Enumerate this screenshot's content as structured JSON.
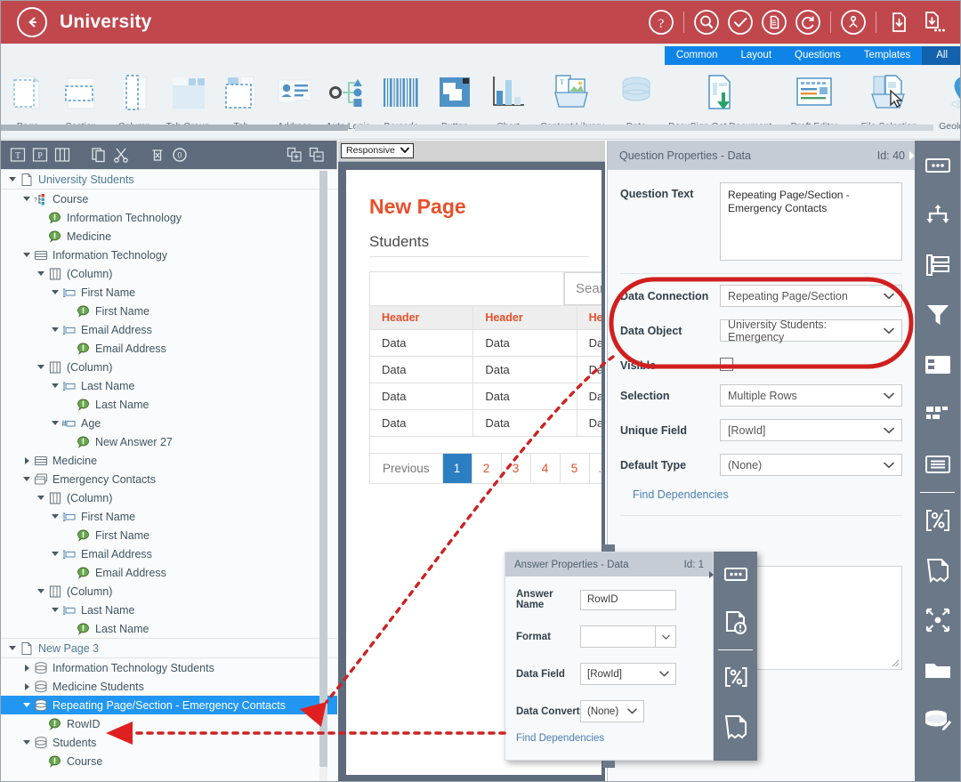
{
  "titlebar": {
    "title": "University",
    "back_icon": "back-arrow-circle-icon",
    "icons": [
      {
        "name": "help-circle-icon"
      },
      {
        "name": "search-circle-icon"
      },
      {
        "name": "check-circle-icon"
      },
      {
        "name": "document-circle-icon"
      },
      {
        "name": "refresh-circle-icon"
      },
      {
        "name": "user-share-circle-icon"
      },
      {
        "name": "document-download-icon"
      },
      {
        "name": "document-download-more-icon"
      }
    ]
  },
  "ribbon": {
    "tabs": [
      {
        "label": "Common",
        "active": false
      },
      {
        "label": "Layout",
        "active": false
      },
      {
        "label": "Questions",
        "active": false
      },
      {
        "label": "Templates",
        "active": false
      },
      {
        "label": "All",
        "active": true
      }
    ],
    "items": [
      {
        "label": "Page",
        "icon": "page-icon"
      },
      {
        "label": "Section",
        "icon": "section-icon"
      },
      {
        "label": "Column",
        "icon": "column-icon"
      },
      {
        "label": "Tab Group",
        "icon": "tab-group-icon"
      },
      {
        "label": "Tab",
        "icon": "tab-icon"
      },
      {
        "label": "Address",
        "icon": "address-card-icon"
      },
      {
        "label": "Auto Logic",
        "icon": "auto-logic-icon"
      },
      {
        "label": "Barcode",
        "icon": "barcode-icon"
      },
      {
        "label": "Button",
        "icon": "button-icon"
      },
      {
        "label": "Chart",
        "icon": "chart-icon"
      },
      {
        "label": "Content Library",
        "icon": "content-library-icon"
      },
      {
        "label": "Data",
        "icon": "database-icon"
      },
      {
        "label": "DocuSign Get Document",
        "icon": "docusign-get-document-icon"
      },
      {
        "label": "Draft Editor",
        "icon": "draft-editor-icon"
      },
      {
        "label": "File Selection",
        "icon": "file-selection-icon"
      },
      {
        "label": "Geolocation",
        "icon": "geolocation-pin-icon"
      }
    ]
  },
  "tree_toolbar": {
    "buttons": [
      {
        "name": "text-tool-icon",
        "label": "T"
      },
      {
        "name": "paragraph-tool-icon",
        "label": "P"
      },
      {
        "name": "columns-tool-icon",
        "label": ""
      },
      {
        "name": "copy-icon",
        "label": ""
      },
      {
        "name": "cut-scissors-icon",
        "label": ""
      },
      {
        "name": "delete-trash-icon",
        "label": ""
      },
      {
        "name": "zero-badge-icon",
        "label": "0"
      },
      {
        "name": "expand-all-icon",
        "label": ""
      },
      {
        "name": "collapse-all-icon",
        "label": ""
      }
    ]
  },
  "tree": {
    "nodes": [
      {
        "label": "University Students",
        "depth": 0,
        "icon": "page-file-icon",
        "arrow": "open",
        "kind": "page"
      },
      {
        "label": "Course",
        "depth": 1,
        "icon": "question-logic-icon",
        "arrow": "open",
        "kind": "question"
      },
      {
        "label": "Information Technology",
        "depth": 2,
        "icon": "answer-bubble-icon",
        "arrow": "none",
        "kind": "answer"
      },
      {
        "label": "Medicine",
        "depth": 2,
        "icon": "answer-bubble-icon",
        "arrow": "none",
        "kind": "answer"
      },
      {
        "label": "Information Technology",
        "depth": 1,
        "icon": "section-box-icon",
        "arrow": "open",
        "kind": "section"
      },
      {
        "label": "(Column)",
        "depth": 2,
        "icon": "column-box-icon",
        "arrow": "open",
        "kind": "column"
      },
      {
        "label": "First Name",
        "depth": 3,
        "icon": "textbox-icon",
        "arrow": "open",
        "kind": "question"
      },
      {
        "label": "First Name",
        "depth": 4,
        "icon": "answer-bubble-icon",
        "arrow": "none",
        "kind": "answer"
      },
      {
        "label": "Email Address",
        "depth": 3,
        "icon": "textbox-icon",
        "arrow": "open",
        "kind": "question"
      },
      {
        "label": "Email Address",
        "depth": 4,
        "icon": "answer-bubble-icon",
        "arrow": "none",
        "kind": "answer"
      },
      {
        "label": "(Column)",
        "depth": 2,
        "icon": "column-box-icon",
        "arrow": "open",
        "kind": "column"
      },
      {
        "label": "Last Name",
        "depth": 3,
        "icon": "textbox-icon",
        "arrow": "open",
        "kind": "question"
      },
      {
        "label": "Last Name",
        "depth": 4,
        "icon": "answer-bubble-icon",
        "arrow": "none",
        "kind": "answer"
      },
      {
        "label": "Age",
        "depth": 3,
        "icon": "number-box-icon",
        "arrow": "open",
        "kind": "question"
      },
      {
        "label": "New Answer 27",
        "depth": 4,
        "icon": "answer-bubble-icon",
        "arrow": "none",
        "kind": "answer"
      },
      {
        "label": "Medicine",
        "depth": 1,
        "icon": "section-box-icon",
        "arrow": "closed",
        "kind": "section"
      },
      {
        "label": "Emergency Contacts",
        "depth": 1,
        "icon": "repeating-section-icon",
        "arrow": "open",
        "kind": "section"
      },
      {
        "label": "(Column)",
        "depth": 2,
        "icon": "column-box-icon",
        "arrow": "open",
        "kind": "column"
      },
      {
        "label": "First Name",
        "depth": 3,
        "icon": "textbox-icon",
        "arrow": "open",
        "kind": "question"
      },
      {
        "label": "First Name",
        "depth": 4,
        "icon": "answer-bubble-icon",
        "arrow": "none",
        "kind": "answer"
      },
      {
        "label": "Email Address",
        "depth": 3,
        "icon": "textbox-icon",
        "arrow": "open",
        "kind": "question"
      },
      {
        "label": "Email Address",
        "depth": 4,
        "icon": "answer-bubble-icon",
        "arrow": "none",
        "kind": "answer"
      },
      {
        "label": "(Column)",
        "depth": 2,
        "icon": "column-box-icon",
        "arrow": "open",
        "kind": "column"
      },
      {
        "label": "Last Name",
        "depth": 3,
        "icon": "textbox-icon",
        "arrow": "open",
        "kind": "question"
      },
      {
        "label": "Last Name",
        "depth": 4,
        "icon": "answer-bubble-icon",
        "arrow": "none",
        "kind": "answer"
      },
      {
        "label": "New Page 3",
        "depth": 0,
        "icon": "page-file-icon",
        "arrow": "open",
        "kind": "page"
      },
      {
        "label": "Information Technology Students",
        "depth": 1,
        "icon": "database-icon",
        "arrow": "closed",
        "kind": "data"
      },
      {
        "label": "Medicine Students",
        "depth": 1,
        "icon": "database-icon",
        "arrow": "closed",
        "kind": "data"
      },
      {
        "label": "Repeating Page/Section - Emergency Contacts",
        "depth": 1,
        "icon": "database-icon",
        "arrow": "open",
        "kind": "data",
        "selected": true
      },
      {
        "label": "RowID",
        "depth": 2,
        "icon": "answer-bubble-icon",
        "arrow": "none",
        "kind": "answer"
      },
      {
        "label": "Students",
        "depth": 1,
        "icon": "database-icon",
        "arrow": "open",
        "kind": "data"
      },
      {
        "label": "Course",
        "depth": 2,
        "icon": "answer-bubble-icon",
        "arrow": "none",
        "kind": "answer"
      }
    ]
  },
  "center": {
    "device_select": "Responsive",
    "preview": {
      "title": "New Page",
      "subtitle": "Students",
      "search_placeholder": "Search",
      "headers": [
        "Header",
        "Header",
        "Header"
      ],
      "rows": [
        [
          "Data",
          "Data",
          "Data"
        ],
        [
          "Data",
          "Data",
          "Data"
        ],
        [
          "Data",
          "Data",
          "Data"
        ],
        [
          "Data",
          "Data",
          "Data"
        ]
      ],
      "pager": {
        "previous": "Previous",
        "pages": [
          "1",
          "2",
          "3",
          "4",
          "5"
        ],
        "active": "1",
        "overflow": "…"
      }
    }
  },
  "properties": {
    "header_title": "Question Properties - Data",
    "header_id": "Id: 40",
    "question_text_label": "Question Text",
    "question_text_value": "Repeating Page/Section - Emergency Contacts",
    "data_connection_label": "Data Connection",
    "data_connection_value": "Repeating Page/Section",
    "data_object_label": "Data Object",
    "data_object_value": "University Students: Emergency",
    "visible_label": "Visible",
    "visible_checked": false,
    "selection_label": "Selection",
    "selection_value": "Multiple Rows",
    "unique_field_label": "Unique Field",
    "unique_field_value": "[RowId]",
    "default_type_label": "Default Type",
    "default_type_value": "(None)",
    "find_dependencies_label": "Find Dependencies"
  },
  "answer_dialog": {
    "header_title": "Answer Properties - Data",
    "header_id": "Id: 1",
    "answer_name_label": "Answer Name",
    "answer_name_value": "RowID",
    "format_label": "Format",
    "format_value": "",
    "data_field_label": "Data Field",
    "data_field_value": "[RowId]",
    "data_convert_label": "Data Convert",
    "data_convert_value": "(None)",
    "find_dependencies_label": "Find Dependencies",
    "rail_icons": [
      {
        "name": "answer-list-icon"
      },
      {
        "name": "document-alert-icon"
      },
      {
        "name": "percent-brackets-icon"
      },
      {
        "name": "document-torn-icon"
      }
    ]
  },
  "rail": {
    "icons": [
      {
        "name": "answer-list-icon"
      },
      {
        "name": "branching-logic-icon"
      },
      {
        "name": "repeat-list-icon"
      },
      {
        "name": "filter-funnel-icon"
      },
      {
        "name": "layout-panel-icon"
      },
      {
        "name": "grid-blocks-icon"
      },
      {
        "name": "lines-panel-icon"
      },
      {
        "name": "percent-brackets-icon"
      },
      {
        "name": "document-torn-icon"
      },
      {
        "name": "expand-arrows-icon"
      },
      {
        "name": "folder-icon"
      },
      {
        "name": "database-edit-icon"
      }
    ]
  },
  "annotations": {
    "highlight_color": "#d11f1f",
    "arrow_color": "#cc2222",
    "ellipse_label": "data-connection-highlight-ellipse",
    "arrow_1_label": "arrow-to-tree-node",
    "arrow_2_label": "arrow-to-rowid-node"
  }
}
